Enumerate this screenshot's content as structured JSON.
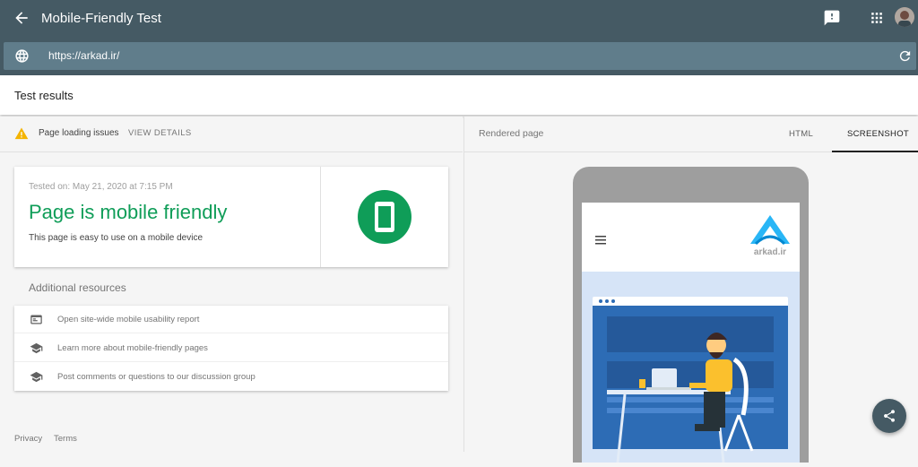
{
  "header": {
    "title": "Mobile-Friendly Test"
  },
  "url_bar": {
    "url": "https://arkad.ir/"
  },
  "results": {
    "title": "Test results"
  },
  "issues": {
    "text": "Page loading issues",
    "action": "VIEW DETAILS"
  },
  "result_card": {
    "tested_on": "Tested on: May 21, 2020 at 7:15 PM",
    "headline": "Page is mobile friendly",
    "subtext": "This page is easy to use on a mobile device"
  },
  "additional": {
    "title": "Additional resources",
    "items": [
      {
        "label": "Open site-wide mobile usability report",
        "icon": "report-icon"
      },
      {
        "label": "Learn more about mobile-friendly pages",
        "icon": "school-icon"
      },
      {
        "label": "Post comments or questions to our discussion group",
        "icon": "school-icon"
      }
    ]
  },
  "footer": {
    "privacy": "Privacy",
    "terms": "Terms"
  },
  "preview": {
    "label": "Rendered page",
    "tabs": [
      "HTML",
      "SCREENSHOT"
    ],
    "active_tab": "SCREENSHOT",
    "site_logo_text": "arkad.ir"
  },
  "colors": {
    "header_bg": "#455a64",
    "url_bar_bg": "#607d8b",
    "success_green": "#0f9d58",
    "warning_yellow": "#f4b400"
  }
}
